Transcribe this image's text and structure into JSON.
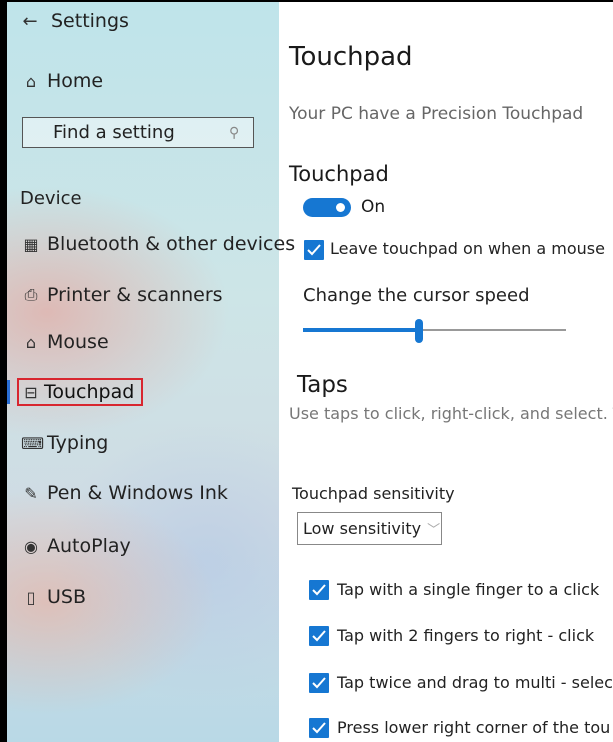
{
  "sidebar": {
    "back_label": "Settings",
    "home_label": "Home",
    "search_placeholder": "Find a setting",
    "section_label": "Device",
    "items": [
      {
        "label": "Bluetooth & other devices",
        "icon": "bluetooth-devices-icon"
      },
      {
        "label": "Printer & scanners",
        "icon": "printer-icon"
      },
      {
        "label": "Mouse",
        "icon": "mouse-icon"
      },
      {
        "label": "Touchpad",
        "icon": "touchpad-icon",
        "selected": true
      },
      {
        "label": "Typing",
        "icon": "keyboard-icon"
      },
      {
        "label": "Pen & Windows Ink",
        "icon": "pen-icon"
      },
      {
        "label": "AutoPlay",
        "icon": "autoplay-icon"
      },
      {
        "label": "USB",
        "icon": "usb-icon"
      }
    ]
  },
  "main": {
    "title": "Touchpad",
    "subtitle": "Your PC have a Precision Touchpad",
    "touchpad_section": {
      "heading": "Touchpad",
      "toggle_state": "On",
      "toggle_on": true,
      "leave_on_label": "Leave touchpad on when a mouse",
      "leave_on_checked": true,
      "cursor_speed_label": "Change the cursor speed",
      "cursor_speed_fraction": 0.44
    },
    "taps_section": {
      "heading": "Taps",
      "description": "Use taps to click, right-click, and select. Turn down the sensitivity if they activate while you’ re typing.",
      "sensitivity_label": "Touchpad sensitivity",
      "sensitivity_value": "Low sensitivity",
      "options": [
        {
          "label": "Tap with a single finger to a click",
          "checked": true
        },
        {
          "label": "Tap with 2 fingers to right - click",
          "checked": true
        },
        {
          "label": "Tap twice and drag to multi - select",
          "checked": true
        },
        {
          "label": "Press lower right corner of the tou",
          "checked": true
        }
      ]
    }
  },
  "colors": {
    "accent": "#1677d2",
    "selection_outline": "#d8262f"
  }
}
